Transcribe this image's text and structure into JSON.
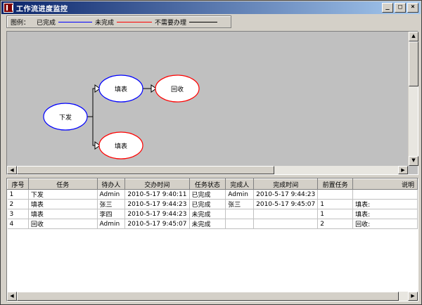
{
  "window": {
    "title": "工作流进度监控",
    "minimize": "_",
    "maximize": "□",
    "close": "×"
  },
  "legend": {
    "label": "图例：",
    "items": [
      {
        "text": "已完成",
        "color": "#0000ff"
      },
      {
        "text": "未完成",
        "color": "#ff0000"
      },
      {
        "text": "不需要办理",
        "color": "#000000"
      }
    ]
  },
  "diagram": {
    "nodes": [
      {
        "id": "xiafa",
        "label": "下发",
        "status_color": "#0000ff"
      },
      {
        "id": "tianbiao1",
        "label": "填表",
        "status_color": "#0000ff"
      },
      {
        "id": "huishou",
        "label": "回收",
        "status_color": "#ff0000"
      },
      {
        "id": "tianbiao2",
        "label": "填表",
        "status_color": "#ff0000"
      }
    ]
  },
  "table": {
    "columns": [
      "序号",
      "任务",
      "待办人",
      "交办时间",
      "任务状态",
      "完成人",
      "完成时间",
      "前置任务",
      "说明"
    ],
    "rows": [
      [
        "1",
        "下发",
        "Admin",
        "2010-5-17 9:40:11",
        "已完成",
        "Admin",
        "2010-5-17 9:44:23",
        "",
        ""
      ],
      [
        "2",
        "填表",
        "张三",
        "2010-5-17 9:44:23",
        "已完成",
        "张三",
        "2010-5-17 9:45:07",
        "1",
        "填表:"
      ],
      [
        "3",
        "填表",
        "李四",
        "2010-5-17 9:44:23",
        "未完成",
        "",
        "",
        "1",
        "填表:"
      ],
      [
        "4",
        "回收",
        "Admin",
        "2010-5-17 9:45:07",
        "未完成",
        "",
        "",
        "2",
        "回收:"
      ]
    ]
  }
}
